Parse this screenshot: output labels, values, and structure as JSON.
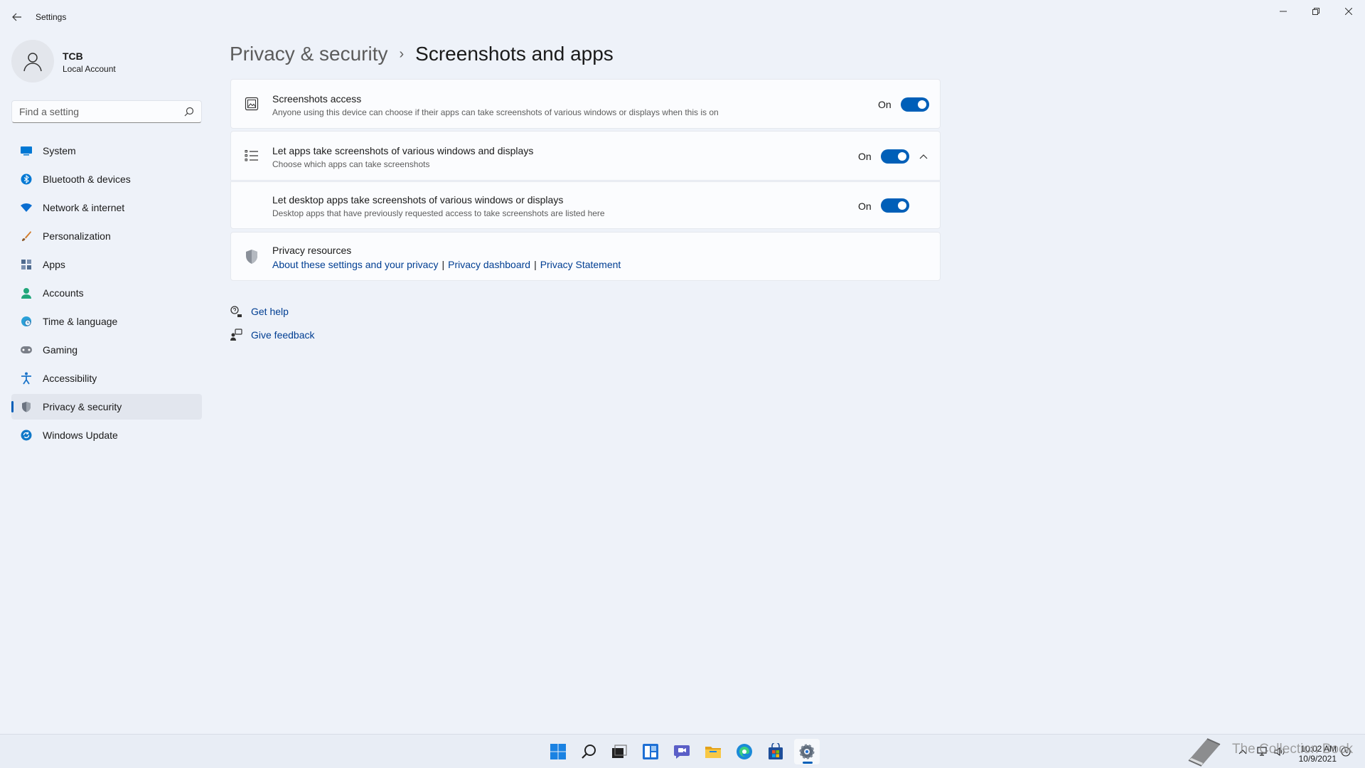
{
  "window": {
    "title": "Settings"
  },
  "profile": {
    "name": "TCB",
    "account_type": "Local Account"
  },
  "search": {
    "placeholder": "Find a setting"
  },
  "sidebar": {
    "items": [
      {
        "label": "System",
        "icon": "monitor-icon",
        "color": "#0078d4"
      },
      {
        "label": "Bluetooth & devices",
        "icon": "bluetooth-icon",
        "color": "#0078d4"
      },
      {
        "label": "Network & internet",
        "icon": "wifi-icon",
        "color": "#0a6ed1"
      },
      {
        "label": "Personalization",
        "icon": "brush-icon",
        "color": "#d27c2b"
      },
      {
        "label": "Apps",
        "icon": "apps-icon",
        "color": "#4f6b8f"
      },
      {
        "label": "Accounts",
        "icon": "person-icon",
        "color": "#21a67a"
      },
      {
        "label": "Time & language",
        "icon": "globe-clock-icon",
        "color": "#2aa0d8"
      },
      {
        "label": "Gaming",
        "icon": "gamepad-icon",
        "color": "#7a7f88"
      },
      {
        "label": "Accessibility",
        "icon": "accessibility-icon",
        "color": "#1b74c9"
      },
      {
        "label": "Privacy & security",
        "icon": "shield-icon",
        "color": "#6b7380",
        "active": true
      },
      {
        "label": "Windows Update",
        "icon": "update-icon",
        "color": "#0f78c8"
      }
    ]
  },
  "breadcrumb": {
    "parent": "Privacy & security",
    "separator": "›",
    "current": "Screenshots and apps"
  },
  "settings": {
    "screenshots_access": {
      "title": "Screenshots access",
      "description": "Anyone using this device can choose if their apps can take screenshots of various windows or displays when this is on",
      "state": "On"
    },
    "let_apps": {
      "title": "Let apps take screenshots of various windows and displays",
      "description": "Choose which apps can take screenshots",
      "state": "On"
    },
    "desktop_apps": {
      "title": "Let desktop apps take screenshots of various windows or displays",
      "description": "Desktop apps that have previously requested access to take screenshots are listed here",
      "state": "On"
    }
  },
  "privacy_resources": {
    "title": "Privacy resources",
    "links": [
      "About these settings and your privacy",
      "Privacy dashboard",
      "Privacy Statement"
    ],
    "separator": "|"
  },
  "help": {
    "get_help": "Get help",
    "give_feedback": "Give feedback"
  },
  "taskbar": {
    "icons": [
      "windows-start-icon",
      "search-icon",
      "task-view-icon",
      "widgets-icon",
      "chat-icon",
      "file-explorer-icon",
      "edge-icon",
      "store-icon",
      "settings-gear-icon"
    ],
    "clock_time": "10:02 AM",
    "clock_date": "10/9/2021",
    "watermark": "The Collection Book"
  },
  "colors": {
    "accent": "#005fb8",
    "link": "#003e92",
    "background": "#eef2f9",
    "card": "#fbfcfe"
  }
}
